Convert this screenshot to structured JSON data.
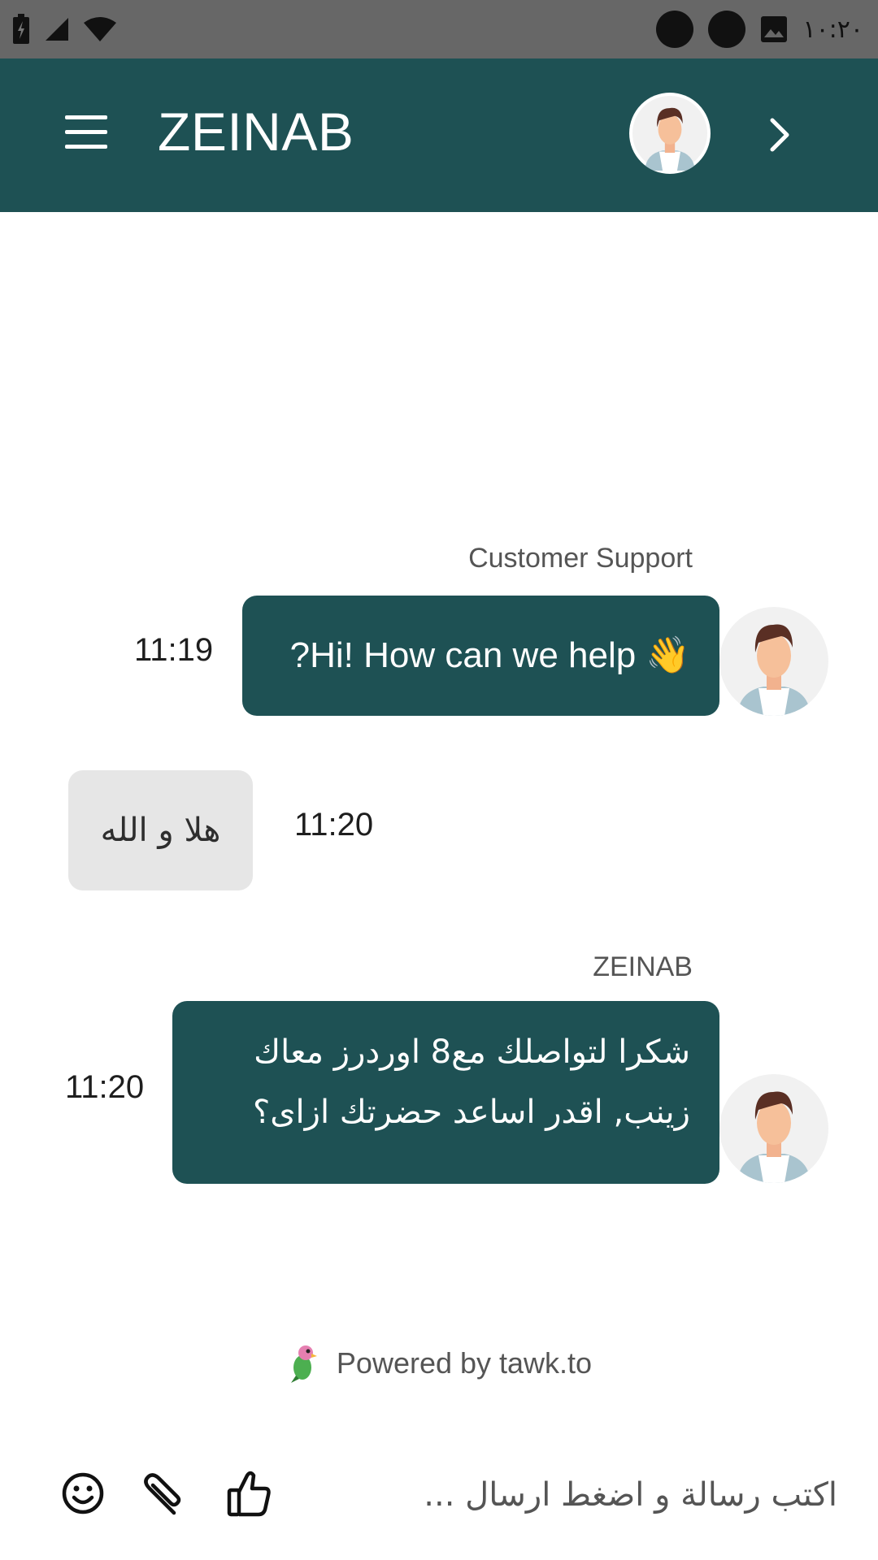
{
  "status_bar": {
    "time": "١٠:٢٠"
  },
  "header": {
    "title": "ZEINAB"
  },
  "messages": [
    {
      "sender": "Customer Support",
      "text": "?Hi! How can we help",
      "emoji": "👋",
      "time": "11:19"
    },
    {
      "text": "هلا و الله",
      "time": "11:20"
    },
    {
      "sender": "ZEINAB",
      "text_line1": "شكرا لتواصلك مع8 اوردرز  معاك",
      "text_line2": "زينب, اقدر اساعد حضرتك ازاى؟",
      "time": "11:20"
    }
  ],
  "footer": {
    "powered_by": "Powered by tawk.to"
  },
  "composer": {
    "placeholder": "اكتب رسالة و اضغط ارسال ..."
  },
  "colors": {
    "brand": "#1e5154",
    "visitor_bubble": "#e6e6e6",
    "status_bar": "#676767"
  }
}
